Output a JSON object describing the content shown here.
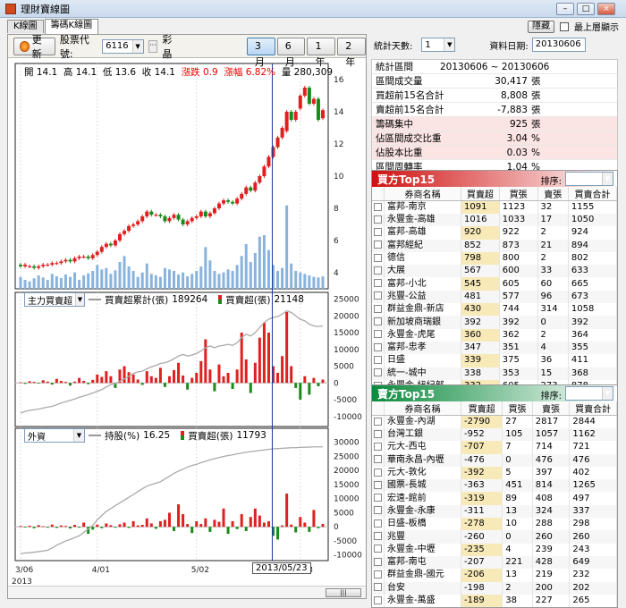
{
  "window": {
    "title": "理財寶線圖",
    "min": "–",
    "max": "□",
    "close": "×"
  },
  "tabs": [
    "K線圖",
    "籌碼K線圖"
  ],
  "top_right": {
    "hide_btn": "隱藏",
    "topmost_label": "最上層顯示"
  },
  "toolbar": {
    "refresh": "更新",
    "stock_label": "股票代號:",
    "stock_code": "6116",
    "stock_name": "彩晶",
    "ellipsis": "···",
    "ranges": [
      "3月",
      "6月",
      "1年",
      "2年"
    ],
    "selected_range": "3月"
  },
  "price_info": {
    "open_lbl": "開",
    "open": "14.1",
    "high_lbl": "高",
    "high": "14.1",
    "low_lbl": "低",
    "low": "13.6",
    "close_lbl": "收",
    "close": "14.1",
    "chg_lbl": "漲跌",
    "chg": "0.9",
    "pct_lbl": "漲幅",
    "pct": "6.82%",
    "vol_lbl": "量",
    "vol": "280,309"
  },
  "panel2": {
    "select": "主力買賣超",
    "legend1": "買賣超累計(張)",
    "legend1_val": "189264",
    "legend2": "買賣超(張)",
    "legend2_val": "21148"
  },
  "panel3": {
    "select": "外資",
    "legend1": "持股(%)",
    "legend1_val": "16.25",
    "legend2": "買賣超(張)",
    "legend2_val": "11793"
  },
  "cursor_date": "2013/05/23",
  "right": {
    "days_label": "統計天數:",
    "days": "1",
    "date_label": "資料日期:",
    "date": "20130606"
  },
  "stats": [
    {
      "label": "統計區間",
      "value": "20130606 ~ 20130606",
      "unit": "",
      "pink": false,
      "center": true
    },
    {
      "label": "區間成交量",
      "value": "30,417",
      "unit": "張",
      "pink": false
    },
    {
      "label": "買超前15名合計",
      "value": "8,808",
      "unit": "張",
      "pink": false
    },
    {
      "label": "賣超前15名合計",
      "value": "-7,883",
      "unit": "張",
      "pink": false
    },
    {
      "label": "籌碼集中",
      "value": "925",
      "unit": "張",
      "pink": true
    },
    {
      "label": "佔區間成交比重",
      "value": "3.04",
      "unit": "%",
      "pink": true
    },
    {
      "label": "佔股本比重",
      "value": "0.03",
      "unit": "%",
      "pink": true
    },
    {
      "label": "區間周轉率",
      "value": "1.04",
      "unit": "%",
      "pink": false
    }
  ],
  "buy_top": {
    "title": "買方Top15",
    "sort_label": "排序:",
    "sort": "買超",
    "headers": [
      "券商名稱",
      "買賣超",
      "買張",
      "賣張",
      "買賣合計"
    ],
    "rows": [
      [
        "富邦-南京",
        "1091",
        "1123",
        "32",
        "1155"
      ],
      [
        "永豐金-高雄",
        "1016",
        "1033",
        "17",
        "1050"
      ],
      [
        "富邦-高雄",
        "920",
        "922",
        "2",
        "924"
      ],
      [
        "富邦經紀",
        "852",
        "873",
        "21",
        "894"
      ],
      [
        "德信",
        "798",
        "800",
        "2",
        "802"
      ],
      [
        "大展",
        "567",
        "600",
        "33",
        "633"
      ],
      [
        "富邦-小北",
        "545",
        "605",
        "60",
        "665"
      ],
      [
        "兆豐-公益",
        "481",
        "577",
        "96",
        "673"
      ],
      [
        "群益金鼎-新店",
        "430",
        "744",
        "314",
        "1058"
      ],
      [
        "新加坡商瑞銀",
        "392",
        "392",
        "0",
        "392"
      ],
      [
        "永豐金-虎尾",
        "360",
        "362",
        "2",
        "364"
      ],
      [
        "富邦-忠孝",
        "347",
        "351",
        "4",
        "355"
      ],
      [
        "日盛",
        "339",
        "375",
        "36",
        "411"
      ],
      [
        "統一-城中",
        "338",
        "353",
        "15",
        "368"
      ],
      [
        "永豐金-紐紀部",
        "332",
        "605",
        "273",
        "878"
      ]
    ]
  },
  "sell_top": {
    "title": "賣方Top15",
    "sort_label": "排序:",
    "sort": "賣超",
    "headers": [
      "券商名稱",
      "買賣超",
      "買張",
      "賣張",
      "買賣合計"
    ],
    "rows": [
      [
        "永豐金-內湖",
        "-2790",
        "27",
        "2817",
        "2844"
      ],
      [
        "台灣工銀",
        "-952",
        "105",
        "1057",
        "1162"
      ],
      [
        "元大-西屯",
        "-707",
        "7",
        "714",
        "721"
      ],
      [
        "華南永昌-內壢",
        "-476",
        "0",
        "476",
        "476"
      ],
      [
        "元大-敦化",
        "-392",
        "5",
        "397",
        "402"
      ],
      [
        "國票-長城",
        "-363",
        "451",
        "814",
        "1265"
      ],
      [
        "宏遠-館前",
        "-319",
        "89",
        "408",
        "497"
      ],
      [
        "永豐金-永康",
        "-311",
        "13",
        "324",
        "337"
      ],
      [
        "日盛-板橋",
        "-278",
        "10",
        "288",
        "298"
      ],
      [
        "兆豐",
        "-260",
        "0",
        "260",
        "260"
      ],
      [
        "永豐金-中壢",
        "-235",
        "4",
        "239",
        "243"
      ],
      [
        "富邦-南屯",
        "-207",
        "221",
        "428",
        "649"
      ],
      [
        "群益金鼎-國元",
        "-206",
        "13",
        "219",
        "232"
      ],
      [
        "台安",
        "-198",
        "2",
        "200",
        "202"
      ],
      [
        "永豐金-萬盛",
        "-189",
        "38",
        "227",
        "265"
      ]
    ]
  },
  "chart_data": [
    {
      "type": "candlestick",
      "ylim": [
        3,
        17
      ],
      "yticks": [
        4,
        6,
        8,
        10,
        12,
        14,
        16
      ],
      "xticklabels": [
        {
          "i": 0,
          "label": "3/06"
        },
        {
          "i": 17,
          "label": "4/01"
        },
        {
          "i": 39,
          "label": "5/02"
        },
        {
          "i": 62,
          "label": "6/03"
        }
      ],
      "year_label": "2013",
      "close": [
        4.4,
        4.5,
        4.4,
        4.3,
        4.4,
        4.5,
        4.5,
        4.6,
        4.6,
        4.7,
        4.8,
        4.7,
        4.9,
        5.0,
        5.0,
        4.9,
        5.1,
        5.3,
        5.6,
        5.8,
        5.7,
        6.0,
        6.4,
        6.6,
        6.9,
        7.0,
        7.2,
        7.5,
        7.8,
        7.6,
        7.6,
        7.5,
        7.2,
        7.4,
        7.6,
        7.3,
        7.0,
        7.2,
        7.4,
        7.5,
        7.8,
        7.5,
        7.7,
        8.0,
        8.3,
        8.5,
        8.4,
        8.3,
        8.6,
        8.9,
        9.3,
        9.1,
        9.6,
        10.0,
        10.6,
        11.2,
        11.8,
        12.4,
        13.0,
        14.0,
        13.5,
        14.0,
        15.0,
        15.5,
        14.5,
        14.8,
        13.5,
        14.1
      ],
      "open": [
        4.5,
        4.4,
        4.4,
        4.4,
        4.3,
        4.4,
        4.5,
        4.5,
        4.6,
        4.6,
        4.7,
        4.8,
        4.7,
        4.9,
        5.0,
        5.0,
        4.9,
        5.1,
        5.3,
        5.6,
        5.8,
        5.7,
        6.0,
        6.4,
        6.6,
        6.9,
        7.0,
        7.2,
        7.5,
        7.8,
        7.6,
        7.6,
        7.5,
        7.2,
        7.4,
        7.6,
        7.3,
        7.0,
        7.2,
        7.4,
        7.5,
        7.8,
        7.5,
        7.7,
        8.0,
        8.3,
        8.5,
        8.4,
        8.3,
        8.6,
        8.9,
        9.3,
        9.1,
        9.6,
        10.0,
        10.6,
        11.2,
        11.8,
        12.4,
        12.8,
        14.0,
        13.5,
        14.2,
        15.0,
        15.5,
        14.5,
        14.8,
        13.6
      ],
      "volume": [
        40,
        30,
        25,
        35,
        45,
        38,
        30,
        50,
        42,
        36,
        48,
        40,
        55,
        30,
        45,
        52,
        60,
        80,
        65,
        70,
        50,
        62,
        90,
        110,
        75,
        60,
        40,
        55,
        85,
        50,
        45,
        40,
        70,
        65,
        60,
        48,
        55,
        42,
        50,
        60,
        75,
        140,
        95,
        60,
        50,
        55,
        65,
        60,
        80,
        110,
        150,
        90,
        120,
        175,
        180,
        130,
        80,
        60,
        70,
        280,
        85,
        60,
        55,
        50,
        45,
        40,
        38,
        42
      ]
    },
    {
      "type": "bar+line",
      "series_name": "買賣超(張)",
      "ylim": [
        -13000,
        27000
      ],
      "yticks": [
        -10000,
        -5000,
        0,
        5000,
        10000,
        15000,
        20000,
        25000
      ],
      "values": [
        200,
        -300,
        500,
        300,
        -200,
        800,
        400,
        -500,
        1200,
        600,
        300,
        -800,
        400,
        1500,
        600,
        -400,
        900,
        2500,
        1800,
        3500,
        2000,
        -1500,
        4000,
        5000,
        3200,
        2500,
        1000,
        -600,
        3500,
        2000,
        1500,
        4500,
        -1200,
        2000,
        3800,
        6000,
        2200,
        -2000,
        1500,
        3000,
        6500,
        13000,
        4000,
        -2500,
        5500,
        2000,
        3000,
        -1800,
        4000,
        15000,
        7000,
        -3000,
        6000,
        13500,
        18000,
        15000,
        5000,
        3000,
        8000,
        21148,
        5000,
        -1500,
        -5000,
        2000,
        -3500,
        1500,
        -1000,
        1000
      ],
      "cumulative": [
        -9000,
        -8500,
        -8200,
        -8000,
        -7800,
        -7500,
        -7200,
        -7000,
        -6500,
        -6000,
        -5600,
        -5200,
        -4800,
        -4300,
        -3900,
        -3500,
        -3000,
        -2500,
        -2000,
        -1200,
        -500,
        -300,
        500,
        1200,
        2000,
        2800,
        3300,
        3500,
        4200,
        4800,
        5200,
        5800,
        6000,
        6500,
        7200,
        8000,
        8500,
        8000,
        8300,
        8800,
        9500,
        10500,
        11000,
        10500,
        11000,
        11200,
        11500,
        11200,
        12000,
        13500,
        14500,
        14000,
        15000,
        16500,
        18000,
        19000,
        19500,
        19800,
        20500,
        21500,
        21000,
        20000,
        19000,
        18500,
        17500,
        17000,
        16800,
        17000
      ]
    },
    {
      "type": "bar+line",
      "series_name": "買賣超(張)",
      "ylim": [
        -12000,
        35000
      ],
      "yticks": [
        -10000,
        -5000,
        0,
        5000,
        10000,
        15000,
        20000,
        25000,
        30000
      ],
      "values": [
        300,
        -200,
        400,
        -500,
        600,
        200,
        -300,
        800,
        -400,
        500,
        300,
        -600,
        700,
        -300,
        1500,
        -2500,
        -1000,
        800,
        -500,
        1200,
        600,
        -300,
        900,
        1500,
        -400,
        2000,
        500,
        700,
        3000,
        1200,
        -700,
        2000,
        2500,
        5000,
        -1500,
        8000,
        4500,
        1000,
        -2200,
        2000,
        1000,
        3000,
        -1800,
        2500,
        1800,
        6500,
        -2500,
        2000,
        -800,
        4500,
        -1500,
        3500,
        6500,
        4000,
        1500,
        2000,
        -3200,
        -4500,
        500,
        11793,
        800,
        -2000,
        3500,
        1500,
        -1800,
        6000,
        -500,
        1000
      ],
      "holding": [
        -9500,
        -9300,
        -9200,
        -9000,
        -8800,
        -8600,
        -8300,
        -7500,
        -6500,
        -5800,
        -5000,
        -4500,
        -3800,
        -3200,
        -2000,
        -800,
        500,
        2500,
        4000,
        5500,
        6500,
        7500,
        8500,
        9500,
        10500,
        11500,
        12500,
        13500,
        14500,
        15000,
        15500,
        16000,
        17000,
        18000,
        19000,
        19800,
        20500,
        21200,
        21800,
        22200,
        22800,
        23300,
        23800,
        24200,
        24600,
        25000,
        25300,
        25600,
        25900,
        26200,
        26500,
        26700,
        26900,
        27100,
        27300,
        27500,
        27700,
        27800,
        27900,
        28000,
        28100,
        28100,
        28200,
        28300,
        28300,
        28400,
        28400,
        28400
      ]
    }
  ]
}
